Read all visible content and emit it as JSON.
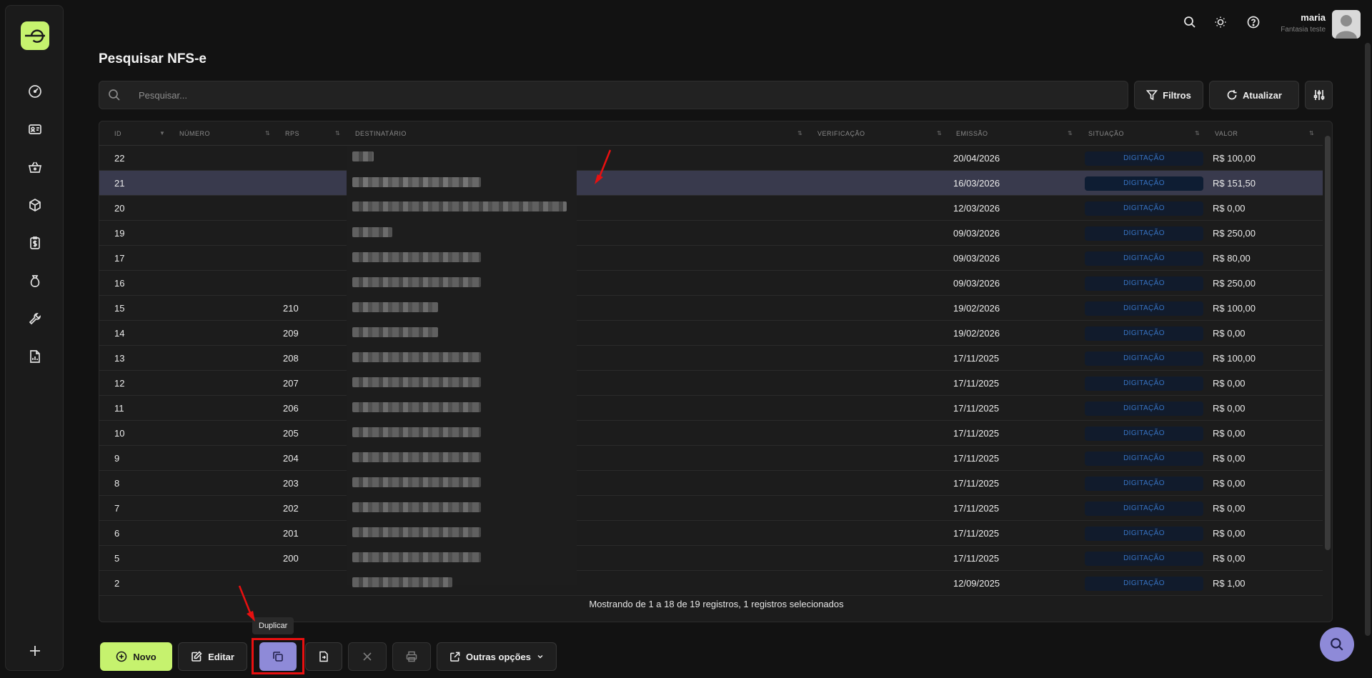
{
  "header": {
    "user_name": "maria",
    "user_subtitle": "Fantasia teste",
    "icons": [
      "search-icon",
      "sun-icon",
      "help-icon",
      "avatar"
    ]
  },
  "sidebar": {
    "items": [
      {
        "name": "dashboard-icon"
      },
      {
        "name": "id-card-icon"
      },
      {
        "name": "basket-icon"
      },
      {
        "name": "package-icon"
      },
      {
        "name": "invoice-icon"
      },
      {
        "name": "money-bag-icon"
      },
      {
        "name": "wrench-icon"
      },
      {
        "name": "report-icon"
      }
    ],
    "add_icon": "plus-icon"
  },
  "page": {
    "title": "Pesquisar NFS-e",
    "search_placeholder": "Pesquisar...",
    "filter_label": "Filtros",
    "refresh_label": "Atualizar"
  },
  "table": {
    "columns": [
      "ID",
      "NÚMERO",
      "RPS",
      "DESTINATÁRIO",
      "VERIFICAÇÃO",
      "EMISSÃO",
      "SITUAÇÃO",
      "VALOR"
    ],
    "rows": [
      {
        "id": "22",
        "rps": "",
        "emissao": "20/04/2026",
        "situacao": "DIGITAÇÃO",
        "valor": "R$ 100,00",
        "selected": false
      },
      {
        "id": "21",
        "rps": "",
        "emissao": "16/03/2026",
        "situacao": "DIGITAÇÃO",
        "valor": "R$ 151,50",
        "selected": true
      },
      {
        "id": "20",
        "rps": "",
        "emissao": "12/03/2026",
        "situacao": "DIGITAÇÃO",
        "valor": "R$ 0,00",
        "selected": false
      },
      {
        "id": "19",
        "rps": "",
        "emissao": "09/03/2026",
        "situacao": "DIGITAÇÃO",
        "valor": "R$ 250,00",
        "selected": false
      },
      {
        "id": "17",
        "rps": "",
        "emissao": "09/03/2026",
        "situacao": "DIGITAÇÃO",
        "valor": "R$ 80,00",
        "selected": false
      },
      {
        "id": "16",
        "rps": "",
        "emissao": "09/03/2026",
        "situacao": "DIGITAÇÃO",
        "valor": "R$ 250,00",
        "selected": false
      },
      {
        "id": "15",
        "rps": "210",
        "emissao": "19/02/2026",
        "situacao": "DIGITAÇÃO",
        "valor": "R$ 100,00",
        "selected": false
      },
      {
        "id": "14",
        "rps": "209",
        "emissao": "19/02/2026",
        "situacao": "DIGITAÇÃO",
        "valor": "R$ 0,00",
        "selected": false
      },
      {
        "id": "13",
        "rps": "208",
        "emissao": "17/11/2025",
        "situacao": "DIGITAÇÃO",
        "valor": "R$ 100,00",
        "selected": false
      },
      {
        "id": "12",
        "rps": "207",
        "emissao": "17/11/2025",
        "situacao": "DIGITAÇÃO",
        "valor": "R$ 0,00",
        "selected": false
      },
      {
        "id": "11",
        "rps": "206",
        "emissao": "17/11/2025",
        "situacao": "DIGITAÇÃO",
        "valor": "R$ 0,00",
        "selected": false
      },
      {
        "id": "10",
        "rps": "205",
        "emissao": "17/11/2025",
        "situacao": "DIGITAÇÃO",
        "valor": "R$ 0,00",
        "selected": false
      },
      {
        "id": "9",
        "rps": "204",
        "emissao": "17/11/2025",
        "situacao": "DIGITAÇÃO",
        "valor": "R$ 0,00",
        "selected": false
      },
      {
        "id": "8",
        "rps": "203",
        "emissao": "17/11/2025",
        "situacao": "DIGITAÇÃO",
        "valor": "R$ 0,00",
        "selected": false
      },
      {
        "id": "7",
        "rps": "202",
        "emissao": "17/11/2025",
        "situacao": "DIGITAÇÃO",
        "valor": "R$ 0,00",
        "selected": false
      },
      {
        "id": "6",
        "rps": "201",
        "emissao": "17/11/2025",
        "situacao": "DIGITAÇÃO",
        "valor": "R$ 0,00",
        "selected": false
      },
      {
        "id": "5",
        "rps": "200",
        "emissao": "17/11/2025",
        "situacao": "DIGITAÇÃO",
        "valor": "R$ 0,00",
        "selected": false
      },
      {
        "id": "2",
        "rps": "",
        "emissao": "12/09/2025",
        "situacao": "DIGITAÇÃO",
        "valor": "R$ 1,00",
        "selected": false
      }
    ],
    "footer": "Mostrando de 1 a 18 de 19 registros, 1 registros selecionados"
  },
  "actions": {
    "novo_label": "Novo",
    "editar_label": "Editar",
    "duplicar_tooltip": "Duplicar",
    "outras_label": "Outras opções"
  },
  "colors": {
    "accent": "#c6f26e",
    "duplicate_button": "#8e8ad8",
    "selected_row": "#393a4d",
    "badge_text": "#3774c5",
    "annotation_red": "#e81010"
  }
}
